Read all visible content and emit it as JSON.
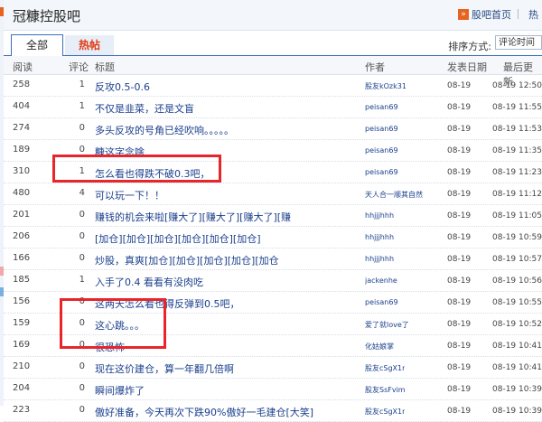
{
  "header": {
    "forum_title": "冠糠控股吧",
    "home_link": "股吧首页",
    "more_link": "热"
  },
  "tabs": [
    {
      "label": "全部"
    },
    {
      "label": "热帖"
    }
  ],
  "sort": {
    "label": "排序方式:",
    "value": "评论时间"
  },
  "table": {
    "columns": {
      "read": "阅读",
      "reply": "评论",
      "title": "标题",
      "author": "作者",
      "date": "发表日期",
      "last": "最后更新"
    },
    "rows": [
      {
        "read": "258",
        "reply": "1",
        "title": "反攻0.5-0.6",
        "author": "股友kOzk31",
        "date": "08-19",
        "last": "08-19 12:50"
      },
      {
        "read": "404",
        "reply": "1",
        "title": "不仅是韭菜，还是文盲",
        "author": "peisan69",
        "date": "08-19",
        "last": "08-19 11:55"
      },
      {
        "read": "274",
        "reply": "0",
        "title": "多头反攻的号角已经吹响。。。。。",
        "author": "peisan69",
        "date": "08-19",
        "last": "08-19 11:53"
      },
      {
        "read": "189",
        "reply": "0",
        "title": "糠这字念啥",
        "author": "peisan69",
        "date": "08-19",
        "last": "08-19 11:35"
      },
      {
        "read": "310",
        "reply": "1",
        "title": "怎么看也得跌不破0.3吧，",
        "author": "peisan69",
        "date": "08-19",
        "last": "08-19 11:23"
      },
      {
        "read": "480",
        "reply": "4",
        "title": "可以玩一下！！",
        "author": "天人合一顺其自然",
        "date": "08-19",
        "last": "08-19 11:12"
      },
      {
        "read": "201",
        "reply": "0",
        "title": "赚钱的机会来啦[赚大了][赚大了][赚大了][赚",
        "author": "hhjjjhhh",
        "date": "08-19",
        "last": "08-19 11:05"
      },
      {
        "read": "206",
        "reply": "0",
        "title": "[加仓][加仓][加仓][加仓][加仓][加仓]",
        "author": "hhjjjhhh",
        "date": "08-19",
        "last": "08-19 10:59"
      },
      {
        "read": "166",
        "reply": "0",
        "title": "炒股，真爽[加仓][加仓][加仓][加仓][加仓",
        "author": "hhjjjhhh",
        "date": "08-19",
        "last": "08-19 10:57"
      },
      {
        "read": "185",
        "reply": "1",
        "title": "入手了0.4 看看有没肉吃",
        "author": "jackenhe",
        "date": "08-19",
        "last": "08-19 10:56"
      },
      {
        "read": "156",
        "reply": "0",
        "title": "这两天怎么看也得反弹到0.5吧，",
        "author": "peisan69",
        "date": "08-19",
        "last": "08-19 10:55"
      },
      {
        "read": "159",
        "reply": "0",
        "title": "这心跳。。。",
        "author": "爱了就love了",
        "date": "08-19",
        "last": "08-19 10:52"
      },
      {
        "read": "169",
        "reply": "0",
        "title": "很恐怖",
        "author": "化姑娘掌",
        "date": "08-19",
        "last": "08-19 10:41"
      },
      {
        "read": "210",
        "reply": "0",
        "title": "现在这价建仓，算一年翻几倍啊",
        "author": "股友cSgX1r",
        "date": "08-19",
        "last": "08-19 10:41"
      },
      {
        "read": "204",
        "reply": "0",
        "title": "瞬间爆炸了",
        "author": "股友SsFvim",
        "date": "08-19",
        "last": "08-19 10:39"
      },
      {
        "read": "223",
        "reply": "0",
        "title": "傲好准备，今天再次下跌90%傲好一毛建仓[大笑]",
        "author": "股友cSgX1r",
        "date": "08-19",
        "last": "08-19 10:39"
      }
    ]
  },
  "colors": {
    "link": "#1a3f8c",
    "highlight": "#e8252a",
    "tab_active_border": "#3a6fb7",
    "hot_tab_text": "#e03c14"
  }
}
